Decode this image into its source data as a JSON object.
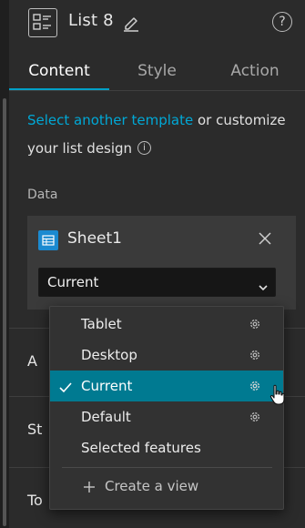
{
  "header": {
    "title": "List 8",
    "icons": {
      "app": "list-widget-icon",
      "edit": "pencil-icon",
      "help": "help-circle-icon"
    },
    "help_glyph": "?"
  },
  "tabs": [
    {
      "label": "Content",
      "active": true
    },
    {
      "label": "Style",
      "active": false
    },
    {
      "label": "Action",
      "active": false
    }
  ],
  "intro": {
    "link_text": "Select another template",
    "rest_text": " or customize your list design",
    "info_glyph": "i"
  },
  "data_section": {
    "label": "Data",
    "source_name": "Sheet1",
    "source_icon": "table-icon",
    "view_select_value": "Current"
  },
  "collapsed_sections": [
    {
      "label": "A"
    },
    {
      "label": "St"
    },
    {
      "label": "To"
    }
  ],
  "view_menu": {
    "items": [
      {
        "label": "Tablet",
        "selected": false,
        "has_settings": true
      },
      {
        "label": "Desktop",
        "selected": false,
        "has_settings": true
      },
      {
        "label": "Current",
        "selected": true,
        "has_settings": true
      },
      {
        "label": "Default",
        "selected": false,
        "has_settings": true
      },
      {
        "label": "Selected features",
        "selected": false,
        "has_settings": false
      }
    ],
    "create_label": "Create a view"
  },
  "colors": {
    "accent": "#00a0c6",
    "link": "#00a8d6",
    "selected_row": "#007a91",
    "panel_bg": "#2b2b2b",
    "sheet_icon": "#1b8ad0"
  }
}
